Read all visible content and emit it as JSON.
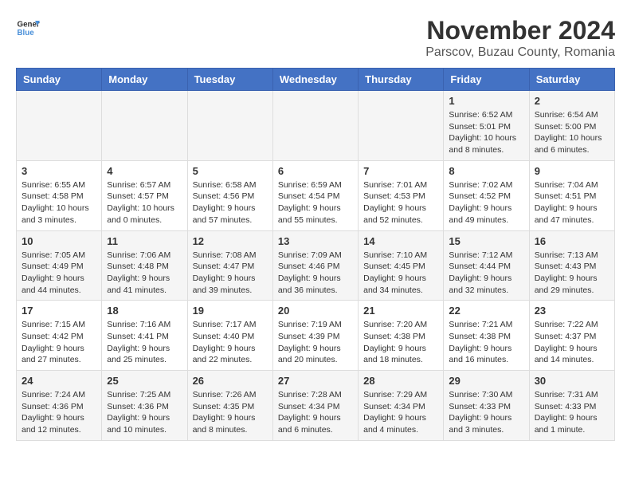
{
  "logo": {
    "general": "General",
    "blue": "Blue"
  },
  "title": "November 2024",
  "subtitle": "Parscov, Buzau County, Romania",
  "weekdays": [
    "Sunday",
    "Monday",
    "Tuesday",
    "Wednesday",
    "Thursday",
    "Friday",
    "Saturday"
  ],
  "weeks": [
    [
      {
        "day": "",
        "info": ""
      },
      {
        "day": "",
        "info": ""
      },
      {
        "day": "",
        "info": ""
      },
      {
        "day": "",
        "info": ""
      },
      {
        "day": "",
        "info": ""
      },
      {
        "day": "1",
        "info": "Sunrise: 6:52 AM\nSunset: 5:01 PM\nDaylight: 10 hours and 8 minutes."
      },
      {
        "day": "2",
        "info": "Sunrise: 6:54 AM\nSunset: 5:00 PM\nDaylight: 10 hours and 6 minutes."
      }
    ],
    [
      {
        "day": "3",
        "info": "Sunrise: 6:55 AM\nSunset: 4:58 PM\nDaylight: 10 hours and 3 minutes."
      },
      {
        "day": "4",
        "info": "Sunrise: 6:57 AM\nSunset: 4:57 PM\nDaylight: 10 hours and 0 minutes."
      },
      {
        "day": "5",
        "info": "Sunrise: 6:58 AM\nSunset: 4:56 PM\nDaylight: 9 hours and 57 minutes."
      },
      {
        "day": "6",
        "info": "Sunrise: 6:59 AM\nSunset: 4:54 PM\nDaylight: 9 hours and 55 minutes."
      },
      {
        "day": "7",
        "info": "Sunrise: 7:01 AM\nSunset: 4:53 PM\nDaylight: 9 hours and 52 minutes."
      },
      {
        "day": "8",
        "info": "Sunrise: 7:02 AM\nSunset: 4:52 PM\nDaylight: 9 hours and 49 minutes."
      },
      {
        "day": "9",
        "info": "Sunrise: 7:04 AM\nSunset: 4:51 PM\nDaylight: 9 hours and 47 minutes."
      }
    ],
    [
      {
        "day": "10",
        "info": "Sunrise: 7:05 AM\nSunset: 4:49 PM\nDaylight: 9 hours and 44 minutes."
      },
      {
        "day": "11",
        "info": "Sunrise: 7:06 AM\nSunset: 4:48 PM\nDaylight: 9 hours and 41 minutes."
      },
      {
        "day": "12",
        "info": "Sunrise: 7:08 AM\nSunset: 4:47 PM\nDaylight: 9 hours and 39 minutes."
      },
      {
        "day": "13",
        "info": "Sunrise: 7:09 AM\nSunset: 4:46 PM\nDaylight: 9 hours and 36 minutes."
      },
      {
        "day": "14",
        "info": "Sunrise: 7:10 AM\nSunset: 4:45 PM\nDaylight: 9 hours and 34 minutes."
      },
      {
        "day": "15",
        "info": "Sunrise: 7:12 AM\nSunset: 4:44 PM\nDaylight: 9 hours and 32 minutes."
      },
      {
        "day": "16",
        "info": "Sunrise: 7:13 AM\nSunset: 4:43 PM\nDaylight: 9 hours and 29 minutes."
      }
    ],
    [
      {
        "day": "17",
        "info": "Sunrise: 7:15 AM\nSunset: 4:42 PM\nDaylight: 9 hours and 27 minutes."
      },
      {
        "day": "18",
        "info": "Sunrise: 7:16 AM\nSunset: 4:41 PM\nDaylight: 9 hours and 25 minutes."
      },
      {
        "day": "19",
        "info": "Sunrise: 7:17 AM\nSunset: 4:40 PM\nDaylight: 9 hours and 22 minutes."
      },
      {
        "day": "20",
        "info": "Sunrise: 7:19 AM\nSunset: 4:39 PM\nDaylight: 9 hours and 20 minutes."
      },
      {
        "day": "21",
        "info": "Sunrise: 7:20 AM\nSunset: 4:38 PM\nDaylight: 9 hours and 18 minutes."
      },
      {
        "day": "22",
        "info": "Sunrise: 7:21 AM\nSunset: 4:38 PM\nDaylight: 9 hours and 16 minutes."
      },
      {
        "day": "23",
        "info": "Sunrise: 7:22 AM\nSunset: 4:37 PM\nDaylight: 9 hours and 14 minutes."
      }
    ],
    [
      {
        "day": "24",
        "info": "Sunrise: 7:24 AM\nSunset: 4:36 PM\nDaylight: 9 hours and 12 minutes."
      },
      {
        "day": "25",
        "info": "Sunrise: 7:25 AM\nSunset: 4:36 PM\nDaylight: 9 hours and 10 minutes."
      },
      {
        "day": "26",
        "info": "Sunrise: 7:26 AM\nSunset: 4:35 PM\nDaylight: 9 hours and 8 minutes."
      },
      {
        "day": "27",
        "info": "Sunrise: 7:28 AM\nSunset: 4:34 PM\nDaylight: 9 hours and 6 minutes."
      },
      {
        "day": "28",
        "info": "Sunrise: 7:29 AM\nSunset: 4:34 PM\nDaylight: 9 hours and 4 minutes."
      },
      {
        "day": "29",
        "info": "Sunrise: 7:30 AM\nSunset: 4:33 PM\nDaylight: 9 hours and 3 minutes."
      },
      {
        "day": "30",
        "info": "Sunrise: 7:31 AM\nSunset: 4:33 PM\nDaylight: 9 hours and 1 minute."
      }
    ]
  ]
}
